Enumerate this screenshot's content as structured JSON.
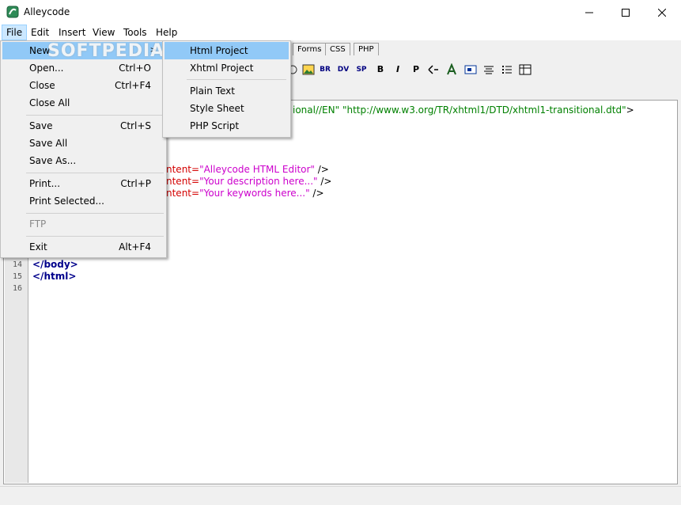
{
  "window": {
    "title": "Alleycode",
    "buttons": {
      "minimize": "—",
      "maximize": "☐",
      "close": "✕"
    }
  },
  "menubar": {
    "items": [
      "File",
      "Edit",
      "Insert",
      "View",
      "Tools",
      "Help"
    ]
  },
  "watermark": "SOFTPEDIA",
  "tabs": [
    "Forms",
    "CSS",
    "PHP"
  ],
  "toolbar": {
    "labels": [
      "BR",
      "DV",
      "SP",
      "B",
      "I",
      "P"
    ]
  },
  "file_menu": {
    "items": [
      {
        "label": "New",
        "shortcut": "",
        "submenu": true
      },
      {
        "label": "Open...",
        "shortcut": "Ctrl+O"
      },
      {
        "label": "Close",
        "shortcut": "Ctrl+F4"
      },
      {
        "label": "Close All",
        "shortcut": ""
      },
      {
        "label": "Save",
        "shortcut": "Ctrl+S"
      },
      {
        "label": "Save All",
        "shortcut": ""
      },
      {
        "label": "Save As...",
        "shortcut": ""
      },
      {
        "label": "Print...",
        "shortcut": "Ctrl+P"
      },
      {
        "label": "Print Selected...",
        "shortcut": ""
      },
      {
        "label": "FTP",
        "shortcut": "",
        "disabled": true
      },
      {
        "label": "Exit",
        "shortcut": "Alt+F4"
      }
    ]
  },
  "new_submenu": {
    "items": [
      "Html Project",
      "Xhtml Project",
      "Plain Text",
      "Style Sheet",
      "PHP Script"
    ]
  },
  "editor": {
    "doctype_tail_1": "ional//EN\"",
    "doctype_tail_2": " \"http://www.w3.org/TR/xhtml1/DTD/xhtml1-transitional.dtd\"",
    "doctype_close": ">",
    "meta1_attr": "ntent=",
    "meta1_val": "\"Alleycode HTML Editor\"",
    "meta2_attr": "ntent=",
    "meta2_val": "\"Your description here...\"",
    "meta3_attr": "ntent=",
    "meta3_val": "\"Your keywords here...\"",
    "meta_close": " />",
    "line14": "</body>",
    "line15": "</html>",
    "line_numbers": [
      "14",
      "15",
      "16"
    ]
  },
  "colors": {
    "menu_highlight": "#91c9f7",
    "tag": "#00008b",
    "string": "#cc00cc",
    "doctype": "#008000",
    "attr": "#d40000"
  }
}
